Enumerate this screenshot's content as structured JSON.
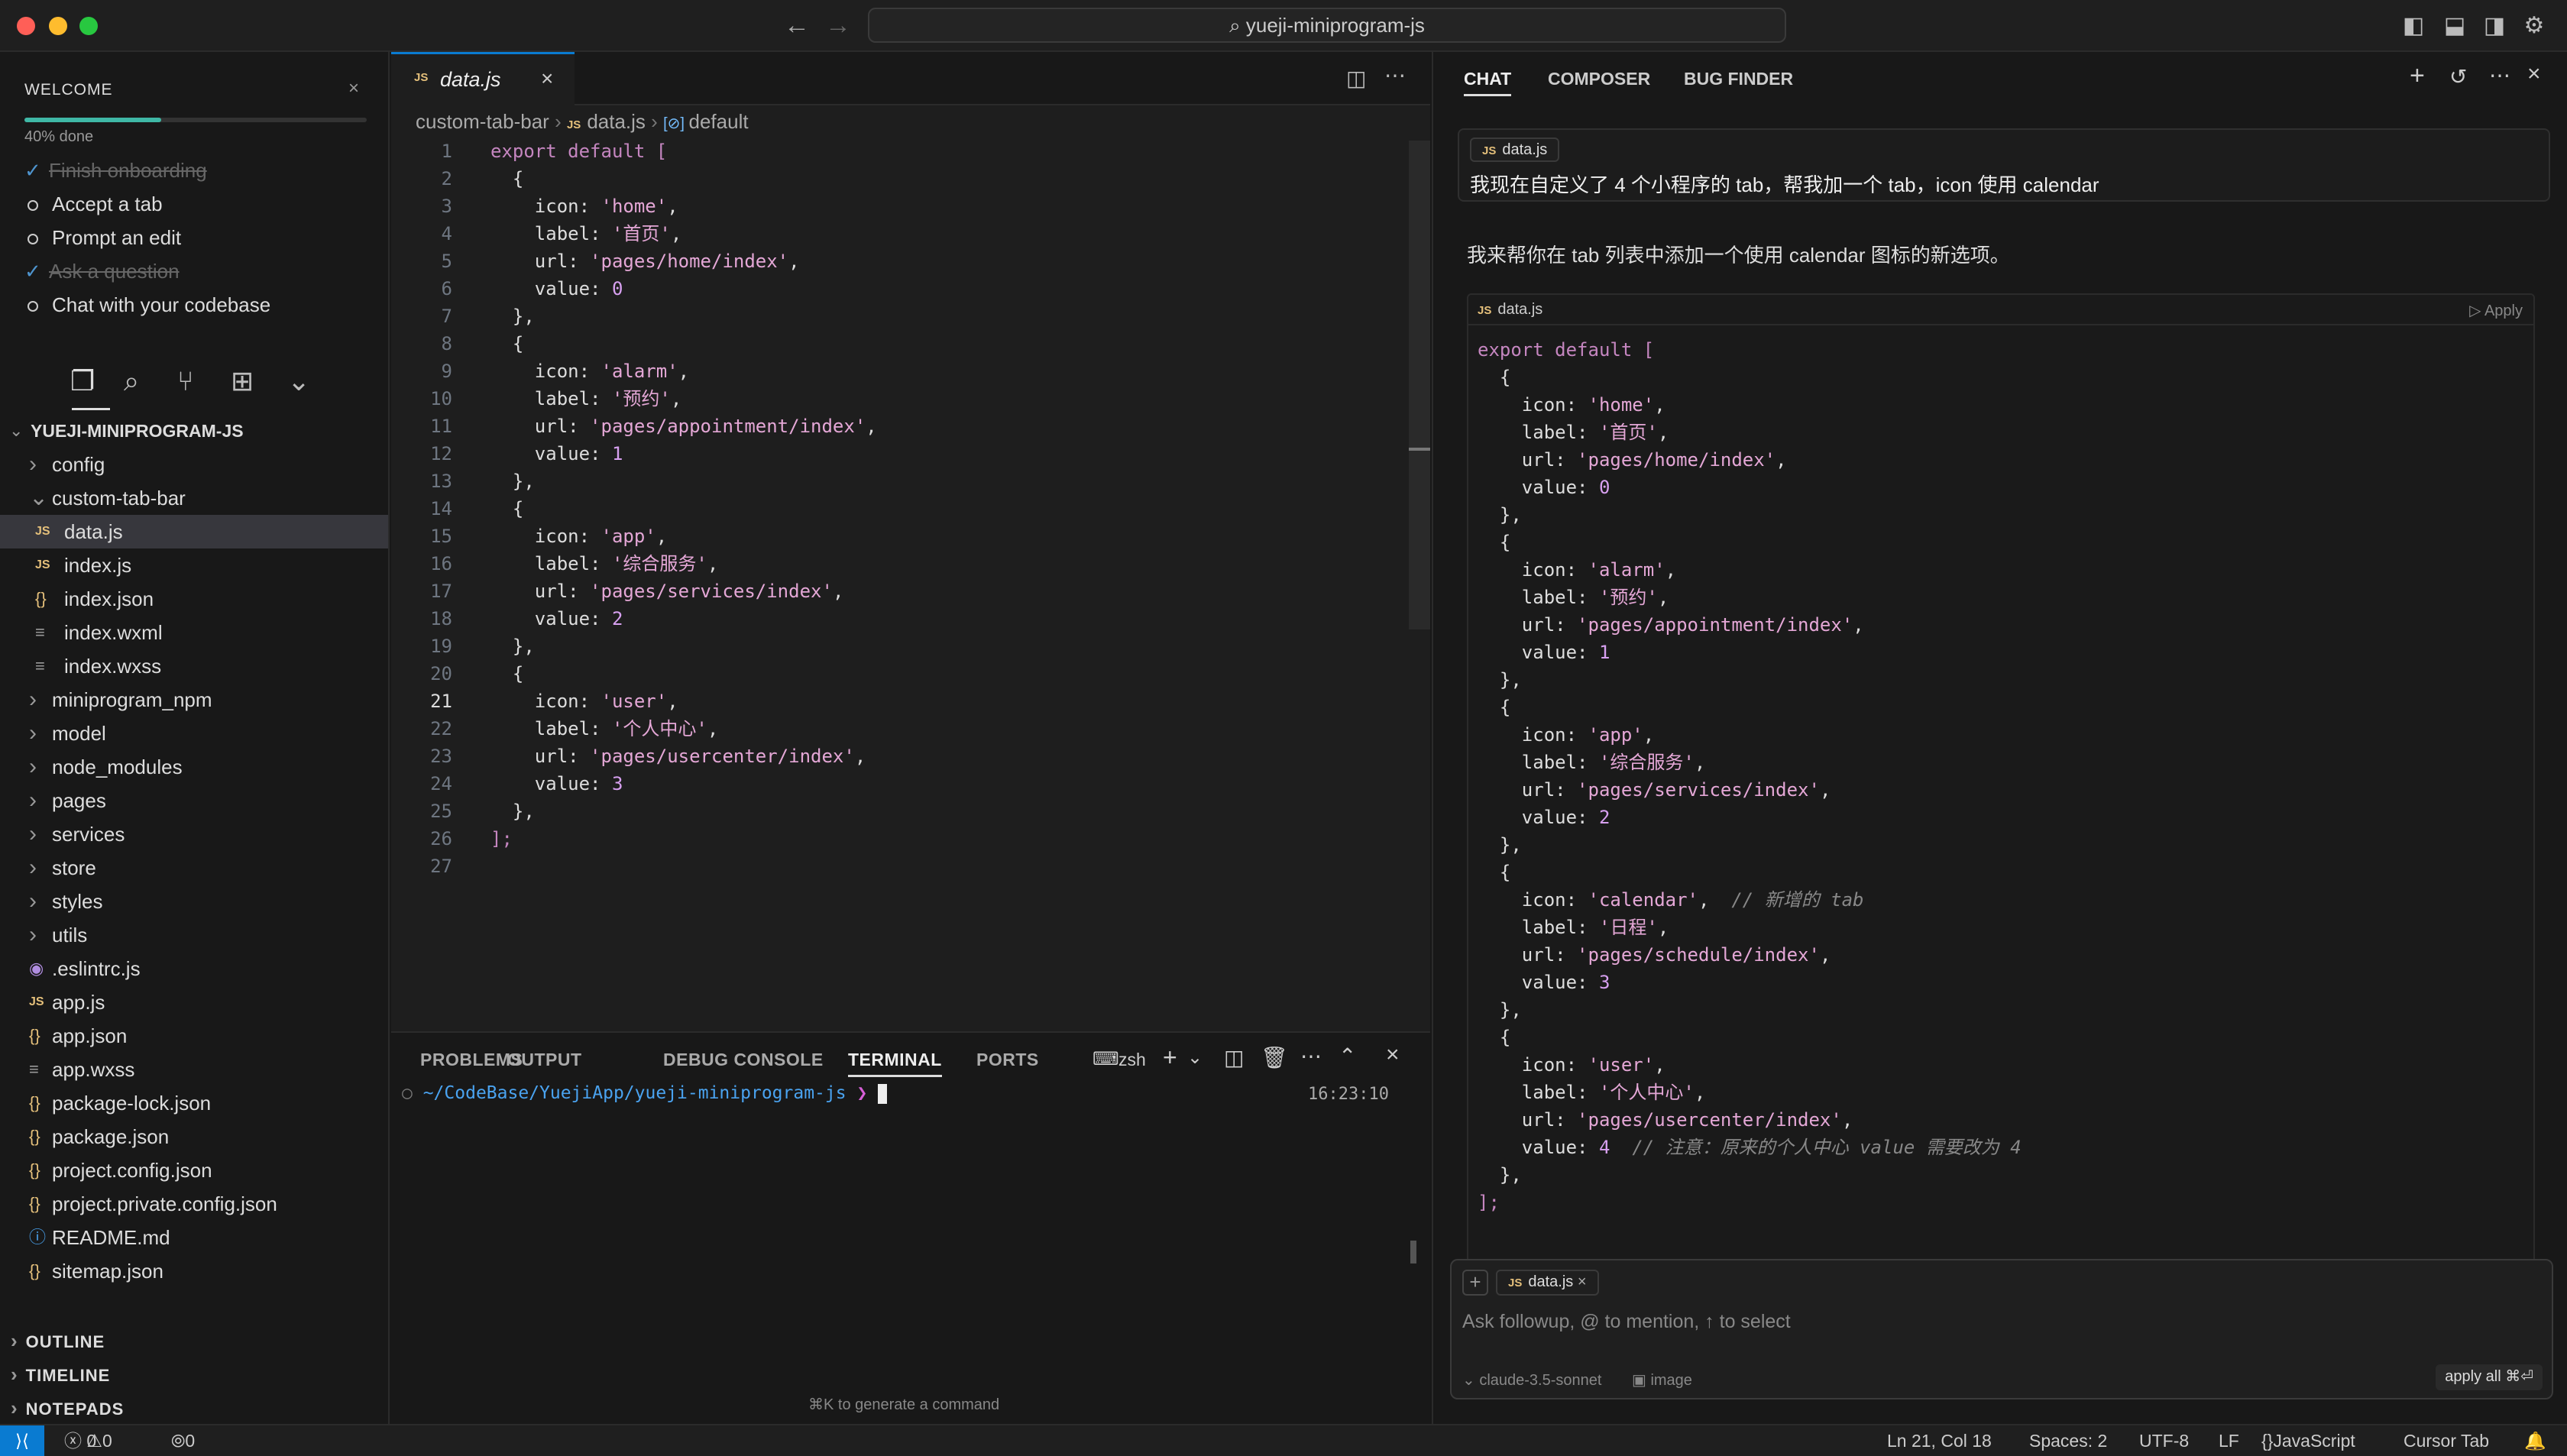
{
  "titlebar": {
    "search_text": "yueji-miniprogram-js"
  },
  "welcome": {
    "title": "WELCOME",
    "progress_percent": 40,
    "progress_label": "40% done",
    "items": [
      {
        "label": "Finish onboarding",
        "done": true
      },
      {
        "label": "Accept a tab",
        "done": false
      },
      {
        "label": "Prompt an edit",
        "done": false
      },
      {
        "label": "Ask a question",
        "done": true
      },
      {
        "label": "Chat with your codebase",
        "done": false
      }
    ]
  },
  "explorer": {
    "root": "YUEJI-MINIPROGRAM-JS",
    "items": [
      {
        "label": "config",
        "icon": "chevron-right",
        "indent": 1
      },
      {
        "label": "custom-tab-bar",
        "icon": "chevron-down",
        "indent": 1
      },
      {
        "label": "data.js",
        "icon": "JS",
        "indent": 2,
        "selected": true
      },
      {
        "label": "index.js",
        "icon": "JS",
        "indent": 2
      },
      {
        "label": "index.json",
        "icon": "{}",
        "indent": 2
      },
      {
        "label": "index.wxml",
        "icon": "≡",
        "indent": 2
      },
      {
        "label": "index.wxss",
        "icon": "≡",
        "indent": 2
      },
      {
        "label": "miniprogram_npm",
        "icon": "chevron-right",
        "indent": 1
      },
      {
        "label": "model",
        "icon": "chevron-right",
        "indent": 1
      },
      {
        "label": "node_modules",
        "icon": "chevron-right",
        "indent": 1
      },
      {
        "label": "pages",
        "icon": "chevron-right",
        "indent": 1
      },
      {
        "label": "services",
        "icon": "chevron-right",
        "indent": 1
      },
      {
        "label": "store",
        "icon": "chevron-right",
        "indent": 1
      },
      {
        "label": "styles",
        "icon": "chevron-right",
        "indent": 1
      },
      {
        "label": "utils",
        "icon": "chevron-right",
        "indent": 1
      },
      {
        "label": ".eslintrc.js",
        "icon": "◉",
        "indent": 1
      },
      {
        "label": "app.js",
        "icon": "JS",
        "indent": 1
      },
      {
        "label": "app.json",
        "icon": "{}",
        "indent": 1
      },
      {
        "label": "app.wxss",
        "icon": "≡",
        "indent": 1
      },
      {
        "label": "package-lock.json",
        "icon": "{}",
        "indent": 1
      },
      {
        "label": "package.json",
        "icon": "{}",
        "indent": 1
      },
      {
        "label": "project.config.json",
        "icon": "{}",
        "indent": 1
      },
      {
        "label": "project.private.config.json",
        "icon": "{}",
        "indent": 1
      },
      {
        "label": "README.md",
        "icon": "ⓘ",
        "indent": 1
      },
      {
        "label": "sitemap.json",
        "icon": "{}",
        "indent": 1
      }
    ],
    "bottom_sections": [
      "OUTLINE",
      "TIMELINE",
      "NOTEPADS"
    ]
  },
  "editor": {
    "tab": "data.js",
    "breadcrumb": [
      "custom-tab-bar",
      "data.js",
      "default"
    ],
    "current_line": 21,
    "lines": [
      [
        [
          "kw",
          "export default "
        ],
        [
          "pu",
          "["
        ]
      ],
      [
        [
          "pr",
          "  {"
        ]
      ],
      [
        [
          "pr",
          "    icon: "
        ],
        [
          "st",
          "'home'"
        ],
        [
          "pr",
          ","
        ]
      ],
      [
        [
          "pr",
          "    label: "
        ],
        [
          "st",
          "'首页'"
        ],
        [
          "pr",
          ","
        ]
      ],
      [
        [
          "pr",
          "    url: "
        ],
        [
          "st",
          "'pages/home/index'"
        ],
        [
          "pr",
          ","
        ]
      ],
      [
        [
          "pr",
          "    value: "
        ],
        [
          "nm",
          "0"
        ]
      ],
      [
        [
          "pr",
          "  },"
        ]
      ],
      [
        [
          "pr",
          "  {"
        ]
      ],
      [
        [
          "pr",
          "    icon: "
        ],
        [
          "st",
          "'alarm'"
        ],
        [
          "pr",
          ","
        ]
      ],
      [
        [
          "pr",
          "    label: "
        ],
        [
          "st",
          "'预约'"
        ],
        [
          "pr",
          ","
        ]
      ],
      [
        [
          "pr",
          "    url: "
        ],
        [
          "st",
          "'pages/appointment/index'"
        ],
        [
          "pr",
          ","
        ]
      ],
      [
        [
          "pr",
          "    value: "
        ],
        [
          "nm",
          "1"
        ]
      ],
      [
        [
          "pr",
          "  },"
        ]
      ],
      [
        [
          "pr",
          "  {"
        ]
      ],
      [
        [
          "pr",
          "    icon: "
        ],
        [
          "st",
          "'app'"
        ],
        [
          "pr",
          ","
        ]
      ],
      [
        [
          "pr",
          "    label: "
        ],
        [
          "st",
          "'综合服务'"
        ],
        [
          "pr",
          ","
        ]
      ],
      [
        [
          "pr",
          "    url: "
        ],
        [
          "st",
          "'pages/services/index'"
        ],
        [
          "pr",
          ","
        ]
      ],
      [
        [
          "pr",
          "    value: "
        ],
        [
          "nm",
          "2"
        ]
      ],
      [
        [
          "pr",
          "  },"
        ]
      ],
      [
        [
          "pr",
          "  {"
        ]
      ],
      [
        [
          "pr",
          "    icon: "
        ],
        [
          "st",
          "'user'"
        ],
        [
          "pr",
          ","
        ]
      ],
      [
        [
          "pr",
          "    label: "
        ],
        [
          "st",
          "'个人中心'"
        ],
        [
          "pr",
          ","
        ]
      ],
      [
        [
          "pr",
          "    url: "
        ],
        [
          "st",
          "'pages/usercenter/index'"
        ],
        [
          "pr",
          ","
        ]
      ],
      [
        [
          "pr",
          "    value: "
        ],
        [
          "nm",
          "3"
        ]
      ],
      [
        [
          "pr",
          "  },"
        ]
      ],
      [
        [
          "pu",
          "];"
        ]
      ],
      []
    ]
  },
  "panel": {
    "tabs": [
      "PROBLEMS",
      "OUTPUT",
      "DEBUG CONSOLE",
      "TERMINAL",
      "PORTS"
    ],
    "active_tab": "TERMINAL",
    "shell": "zsh",
    "prompt_path": "~/CodeBase/YuejiApp/yueji-miniprogram-js",
    "prompt_symbol": "❯",
    "time": "16:23:10",
    "hint": "⌘K to generate a command"
  },
  "chat": {
    "tabs": [
      "CHAT",
      "COMPOSER",
      "BUG FINDER"
    ],
    "active_tab": "CHAT",
    "user_file": "data.js",
    "user_message": "我现在自定义了 4 个小程序的 tab，帮我加一个 tab，icon 使用 calendar",
    "reply": "我来帮你在 tab 列表中添加一个使用 calendar 图标的新选项。",
    "code_file": "data.js",
    "apply_label": "Apply",
    "code_lines": [
      [
        [
          "kw",
          "export default "
        ],
        [
          "pu",
          "["
        ]
      ],
      [
        [
          "pr",
          "  {"
        ]
      ],
      [
        [
          "pr",
          "    icon: "
        ],
        [
          "st",
          "'home'"
        ],
        [
          "pr",
          ","
        ]
      ],
      [
        [
          "pr",
          "    label: "
        ],
        [
          "st",
          "'首页'"
        ],
        [
          "pr",
          ","
        ]
      ],
      [
        [
          "pr",
          "    url: "
        ],
        [
          "st",
          "'pages/home/index'"
        ],
        [
          "pr",
          ","
        ]
      ],
      [
        [
          "pr",
          "    value: "
        ],
        [
          "nm",
          "0"
        ]
      ],
      [
        [
          "pr",
          "  },"
        ]
      ],
      [
        [
          "pr",
          "  {"
        ]
      ],
      [
        [
          "pr",
          "    icon: "
        ],
        [
          "st",
          "'alarm'"
        ],
        [
          "pr",
          ","
        ]
      ],
      [
        [
          "pr",
          "    label: "
        ],
        [
          "st",
          "'预约'"
        ],
        [
          "pr",
          ","
        ]
      ],
      [
        [
          "pr",
          "    url: "
        ],
        [
          "st",
          "'pages/appointment/index'"
        ],
        [
          "pr",
          ","
        ]
      ],
      [
        [
          "pr",
          "    value: "
        ],
        [
          "nm",
          "1"
        ]
      ],
      [
        [
          "pr",
          "  },"
        ]
      ],
      [
        [
          "pr",
          "  {"
        ]
      ],
      [
        [
          "pr",
          "    icon: "
        ],
        [
          "st",
          "'app'"
        ],
        [
          "pr",
          ","
        ]
      ],
      [
        [
          "pr",
          "    label: "
        ],
        [
          "st",
          "'综合服务'"
        ],
        [
          "pr",
          ","
        ]
      ],
      [
        [
          "pr",
          "    url: "
        ],
        [
          "st",
          "'pages/services/index'"
        ],
        [
          "pr",
          ","
        ]
      ],
      [
        [
          "pr",
          "    value: "
        ],
        [
          "nm",
          "2"
        ]
      ],
      [
        [
          "pr",
          "  },"
        ]
      ],
      [
        [
          "pr",
          "  {"
        ]
      ],
      [
        [
          "pr",
          "    icon: "
        ],
        [
          "st",
          "'calendar'"
        ],
        [
          "pr",
          ",  "
        ],
        [
          "cm",
          "// 新增的 tab"
        ]
      ],
      [
        [
          "pr",
          "    label: "
        ],
        [
          "st",
          "'日程'"
        ],
        [
          "pr",
          ","
        ]
      ],
      [
        [
          "pr",
          "    url: "
        ],
        [
          "st",
          "'pages/schedule/index'"
        ],
        [
          "pr",
          ","
        ]
      ],
      [
        [
          "pr",
          "    value: "
        ],
        [
          "nm",
          "3"
        ]
      ],
      [
        [
          "pr",
          "  },"
        ]
      ],
      [
        [
          "pr",
          "  {"
        ]
      ],
      [
        [
          "pr",
          "    icon: "
        ],
        [
          "st",
          "'user'"
        ],
        [
          "pr",
          ","
        ]
      ],
      [
        [
          "pr",
          "    label: "
        ],
        [
          "st",
          "'个人中心'"
        ],
        [
          "pr",
          ","
        ]
      ],
      [
        [
          "pr",
          "    url: "
        ],
        [
          "st",
          "'pages/usercenter/index'"
        ],
        [
          "pr",
          ","
        ]
      ],
      [
        [
          "pr",
          "    value: "
        ],
        [
          "nm",
          "4"
        ],
        [
          "pr",
          "  "
        ],
        [
          "cm",
          "// 注意：原来的个人中心 value 需要改为 4"
        ]
      ],
      [
        [
          "pr",
          "  },"
        ]
      ],
      [
        [
          "pu",
          "];"
        ]
      ]
    ],
    "input_file": "data.js",
    "input_placeholder": "Ask followup, @ to mention, ↑ to select",
    "model": "claude-3.5-sonnet",
    "image_label": "image",
    "apply_all": "apply all ⌘⏎"
  },
  "status": {
    "errors": "0",
    "warnings": "0",
    "ports": "0",
    "position": "Ln 21, Col 18",
    "spaces": "Spaces: 2",
    "encoding": "UTF-8",
    "eol": "LF",
    "language": "JavaScript",
    "cursor_tab": "Cursor Tab"
  }
}
